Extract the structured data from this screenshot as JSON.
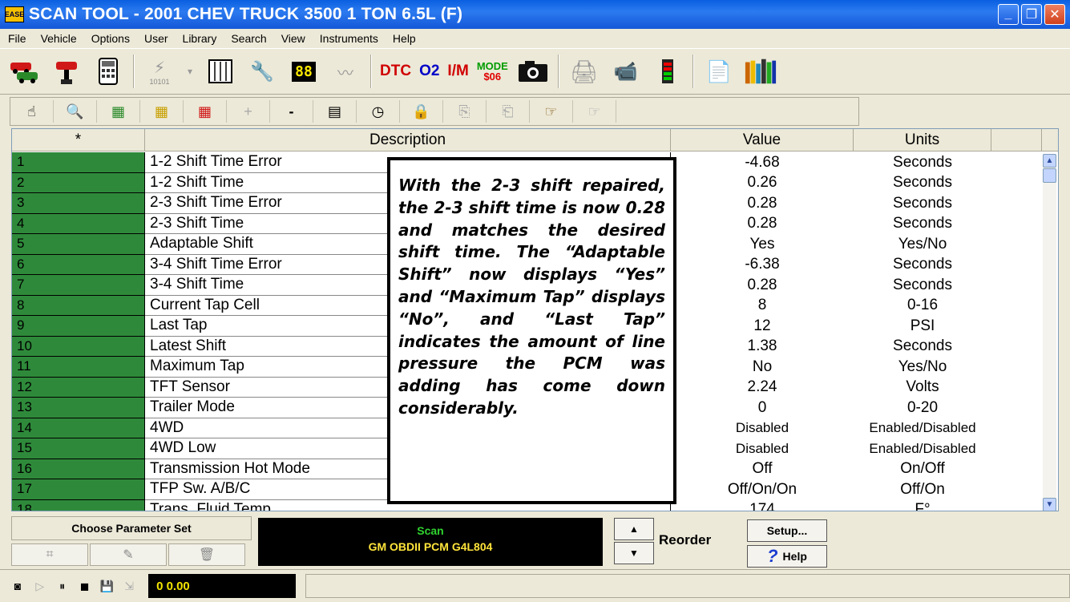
{
  "window": {
    "title": "SCAN TOOL - 2001 CHEV TRUCK 3500 1 TON 6.5L (F)",
    "icon_text": "EASE",
    "minimize_glyph": "_",
    "maximize_glyph": "❐",
    "close_glyph": "✕"
  },
  "menu": [
    "File",
    "Vehicle",
    "Options",
    "User",
    "Library",
    "Search",
    "View",
    "Instruments",
    "Help"
  ],
  "toolbar": {
    "items": [
      "cars-icon",
      "plug-icon",
      "calculator-icon",
      "lightning-icon",
      "table-icon",
      "tools-icon",
      "digital-display-icon",
      "graph-icon",
      "dtc",
      "o2",
      "im",
      "mode",
      "camera-icon",
      "printer-icon",
      "video-icon",
      "meter-icon",
      "document-icon",
      "books-icon"
    ],
    "digit_label": "88",
    "small_label": "10101",
    "dtc_label": "DTC",
    "o2_label": "O2",
    "im_label": "I/M",
    "mode_label": "MODE",
    "mode_sub": "$06"
  },
  "grid": {
    "headers": {
      "star": "*",
      "description": "Description",
      "value": "Value",
      "units": "Units"
    },
    "rows": [
      {
        "num": "1",
        "desc": "1-2 Shift Time Error",
        "value": "-4.68",
        "units": "Seconds"
      },
      {
        "num": "2",
        "desc": "1-2 Shift Time",
        "value": "0.26",
        "units": "Seconds"
      },
      {
        "num": "3",
        "desc": "2-3 Shift Time Error",
        "value": "0.28",
        "units": "Seconds"
      },
      {
        "num": "4",
        "desc": "2-3 Shift Time",
        "value": "0.28",
        "units": "Seconds"
      },
      {
        "num": "5",
        "desc": "Adaptable Shift",
        "value": "Yes",
        "units": "Yes/No"
      },
      {
        "num": "6",
        "desc": "3-4 Shift Time Error",
        "value": "-6.38",
        "units": "Seconds"
      },
      {
        "num": "7",
        "desc": "3-4 Shift Time",
        "value": "0.28",
        "units": "Seconds"
      },
      {
        "num": "8",
        "desc": "Current Tap Cell",
        "value": "8",
        "units": "0-16"
      },
      {
        "num": "9",
        "desc": "Last Tap",
        "value": "12",
        "units": "PSI"
      },
      {
        "num": "10",
        "desc": "Latest Shift",
        "value": "1.38",
        "units": "Seconds"
      },
      {
        "num": "11",
        "desc": "Maximum Tap",
        "value": "No",
        "units": "Yes/No"
      },
      {
        "num": "12",
        "desc": "TFT Sensor",
        "value": "2.24",
        "units": "Volts"
      },
      {
        "num": "13",
        "desc": "Trailer Mode",
        "value": "0",
        "units": "0-20"
      },
      {
        "num": "14",
        "desc": "4WD",
        "value": "Disabled",
        "units": "Enabled/Disabled"
      },
      {
        "num": "15",
        "desc": "4WD Low",
        "value": "Disabled",
        "units": "Enabled/Disabled"
      },
      {
        "num": "16",
        "desc": "Transmission Hot Mode",
        "value": "Off",
        "units": "On/Off"
      },
      {
        "num": "17",
        "desc": "TFP Sw. A/B/C",
        "value": "Off/On/On",
        "units": "Off/On"
      },
      {
        "num": "18",
        "desc": "Trans. Fluid Temp.",
        "value": "174",
        "units": "F°"
      }
    ]
  },
  "callout": {
    "text": "With the 2-3 shift repaired, the 2-3 shift time is now 0.28 and matches the desired shift time. The “Adaptable Shift” now displays “Yes” and “Maximum Tap” displays “No”, and “Last Tap” indicates the amount of line pressure the PCM was adding has come down considerably."
  },
  "bottom": {
    "choose_param_label": "Choose Parameter Set",
    "scan_label": "Scan",
    "scan_module": "GM OBDII PCM G4L804",
    "reorder_label": "Reorder",
    "setup_label": "Setup...",
    "help_label": "Help"
  },
  "status": {
    "timer": "0  0.00"
  }
}
